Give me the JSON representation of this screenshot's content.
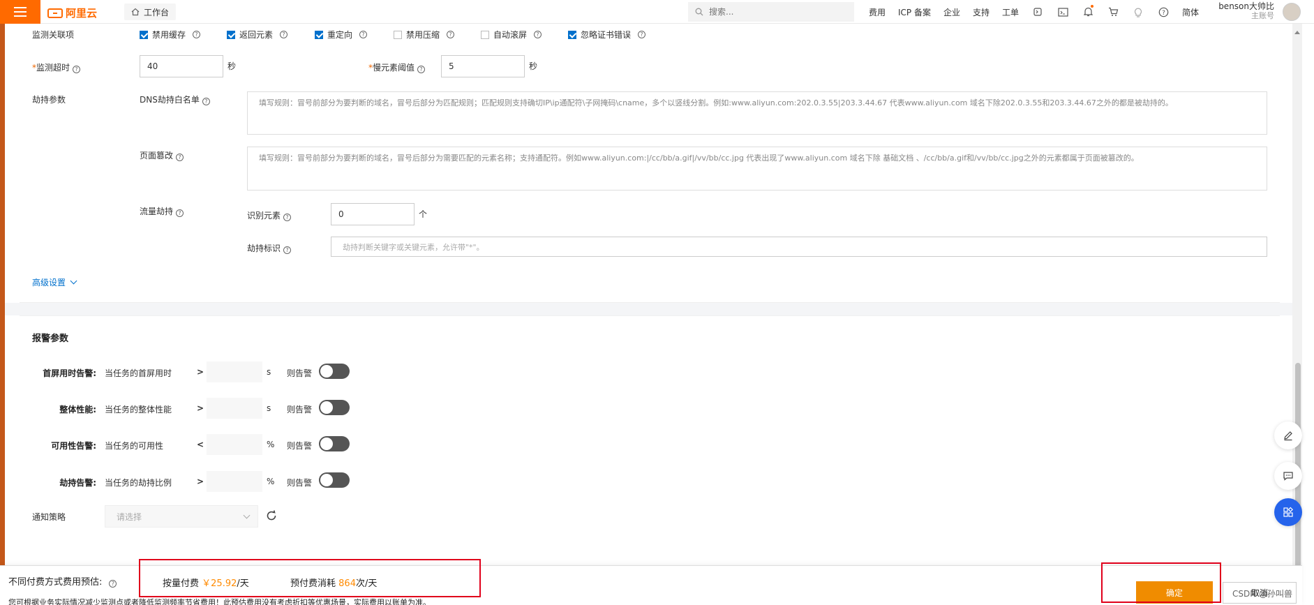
{
  "topbar": {
    "logo_text": "阿里云",
    "workbench_label": "工作台",
    "search_placeholder": "搜索...",
    "links": [
      "费用",
      "ICP 备案",
      "企业",
      "支持",
      "工单"
    ],
    "lang": "简体",
    "user_name": "benson大帅比",
    "user_role": "主账号"
  },
  "monitor": {
    "ignore_label": "监测关联项",
    "checkboxes": [
      {
        "label": "禁用缓存",
        "checked": true
      },
      {
        "label": "返回元素",
        "checked": true
      },
      {
        "label": "重定向",
        "checked": true
      },
      {
        "label": "禁用压缩",
        "checked": false
      },
      {
        "label": "自动滚屏",
        "checked": false
      },
      {
        "label": "忽略证书错误",
        "checked": true
      }
    ],
    "timeout_label": "监测超时",
    "timeout_value": "40",
    "timeout_unit": "秒",
    "slow_label": "慢元素阈值",
    "slow_value": "5",
    "slow_unit": "秒"
  },
  "hijack": {
    "section_label": "劫持参数",
    "dns_label": "DNS劫持白名单",
    "dns_placeholder": "填写规则：冒号前部分为要判断的域名，冒号后部分为匹配规则；匹配规则支持确切IP\\ip通配符\\子网掩码\\cname，多个以竖线分割。例如:www.aliyun.com:202.0.3.55|203.3.44.67  代表www.aliyun.com 域名下除202.0.3.55和203.3.44.67之外的都是被劫持的。",
    "page_label": "页面篡改",
    "page_placeholder": "填写规则：冒号前部分为要判断的域名，冒号后部分为需要匹配的元素名称；支持通配符。例如www.aliyun.com:|/cc/bb/a.gif|/vv/bb/cc.jpg 代表出现了www.aliyun.com 域名下除 基础文档 、/cc/bb/a.gif和/vv/bb/cc.jpg之外的元素都属于页面被篡改的。",
    "traffic_label": "流量劫持",
    "identify_label": "识别元素",
    "identify_value": "0",
    "identify_unit": "个",
    "mark_label": "劫持标识",
    "mark_placeholder": "劫持判断关键字或关键元素，允许带\"*\"。",
    "advanced_label": "高级设置"
  },
  "alarm": {
    "title": "报警参数",
    "rows": [
      {
        "name": "首屏用时告警:",
        "desc": "当任务的首屏用时",
        "op": ">",
        "unit": "s",
        "then": "则告警",
        "on": false
      },
      {
        "name": "整体性能:",
        "desc": "当任务的整体性能",
        "op": ">",
        "unit": "s",
        "then": "则告警",
        "on": false
      },
      {
        "name": "可用性告警:",
        "desc": "当任务的可用性",
        "op": "<",
        "unit": "%",
        "then": "则告警",
        "on": false
      },
      {
        "name": "劫持告警:",
        "desc": "当任务的劫持比例",
        "op": ">",
        "unit": "%",
        "then": "则告警",
        "on": false
      }
    ],
    "notify_label": "通知策略",
    "notify_placeholder": "请选择"
  },
  "footer": {
    "estimate_label": "不同付费方式费用预估:",
    "payg_label": "按量付费",
    "payg_value": "￥25.92",
    "payg_unit": "/天",
    "prepaid_label": "预付费消耗",
    "prepaid_value": "864",
    "prepaid_unit": "次/天",
    "note": "您可根据业务实际情况减少监测点或者降低监测频率节省费用！此预估费用没有考虑折扣等优惠场景，实际费用以账单为准。",
    "confirm_label": "确定",
    "cancel_label": "取消",
    "watermark": "CSDN @孙叫兽"
  },
  "colors": {
    "accent": "#ff6a00",
    "primary": "#0070cc",
    "confirm": "#f08c00",
    "highlight": "#e0001b"
  }
}
